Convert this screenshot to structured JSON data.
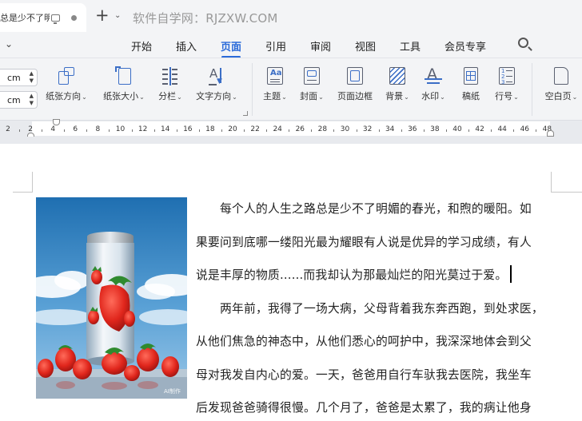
{
  "titlebar": {
    "doc_tab_label": "总是少不了明",
    "site_title": "软件自学网：RJZXW.COM"
  },
  "menu": {
    "items": [
      {
        "label": "开始",
        "active": false
      },
      {
        "label": "插入",
        "active": false
      },
      {
        "label": "页面",
        "active": true
      },
      {
        "label": "引用",
        "active": false
      },
      {
        "label": "审阅",
        "active": false
      },
      {
        "label": "视图",
        "active": false
      },
      {
        "label": "工具",
        "active": false
      },
      {
        "label": "会员专享",
        "active": false
      }
    ]
  },
  "ribbon": {
    "margin_unit_1": "cm",
    "margin_unit_2": "cm",
    "buttons": [
      {
        "label": "纸张方向",
        "icon": "paper-orientation-icon"
      },
      {
        "label": "纸张大小",
        "icon": "paper-size-icon"
      },
      {
        "label": "分栏",
        "icon": "columns-icon"
      },
      {
        "label": "文字方向",
        "icon": "text-direction-icon"
      },
      {
        "label": "主题",
        "icon": "theme-icon"
      },
      {
        "label": "封面",
        "icon": "cover-icon"
      },
      {
        "label": "页面边框",
        "icon": "page-border-icon"
      },
      {
        "label": "背景",
        "icon": "background-icon"
      },
      {
        "label": "水印",
        "icon": "watermark-icon"
      },
      {
        "label": "稿纸",
        "icon": "manuscript-icon"
      },
      {
        "label": "行号",
        "icon": "line-number-icon"
      },
      {
        "label": "空白页",
        "icon": "blank-page-icon"
      }
    ]
  },
  "ruler": {
    "labels": [
      "2",
      "2",
      "4",
      "6",
      "8",
      "10",
      "12",
      "14",
      "16",
      "18",
      "20",
      "22",
      "24",
      "26",
      "28",
      "30",
      "32",
      "34",
      "36",
      "38",
      "40",
      "42",
      "44",
      "46",
      "48"
    ]
  },
  "document": {
    "image_watermark": "AI制作",
    "lines": [
      "　　每个人的人生之路总是少不了明媚的春光，和煦的暖阳。如",
      "果要问到底哪一缕阳光最为耀眼有人说是优异的学习成绩，有人",
      "说是丰厚的物质......而我却认为那最灿烂的阳光莫过于爱。",
      "　　两年前，我得了一场大病，父母背着我东奔西跑，到处求医，",
      "从他们焦急的神态中，从他们悉心的呵护中，我深深地体会到父",
      "母对我发自内心的爱。一天，爸爸用自行车驮我去医院，我坐车",
      "后发现爸爸骑得很慢。几个月了，爸爸是太累了，我的病让他身"
    ]
  },
  "colors": {
    "accent": "#2b6bd9",
    "chrome": "#f3f4f6",
    "icon_blue": "#3b6ec6"
  }
}
